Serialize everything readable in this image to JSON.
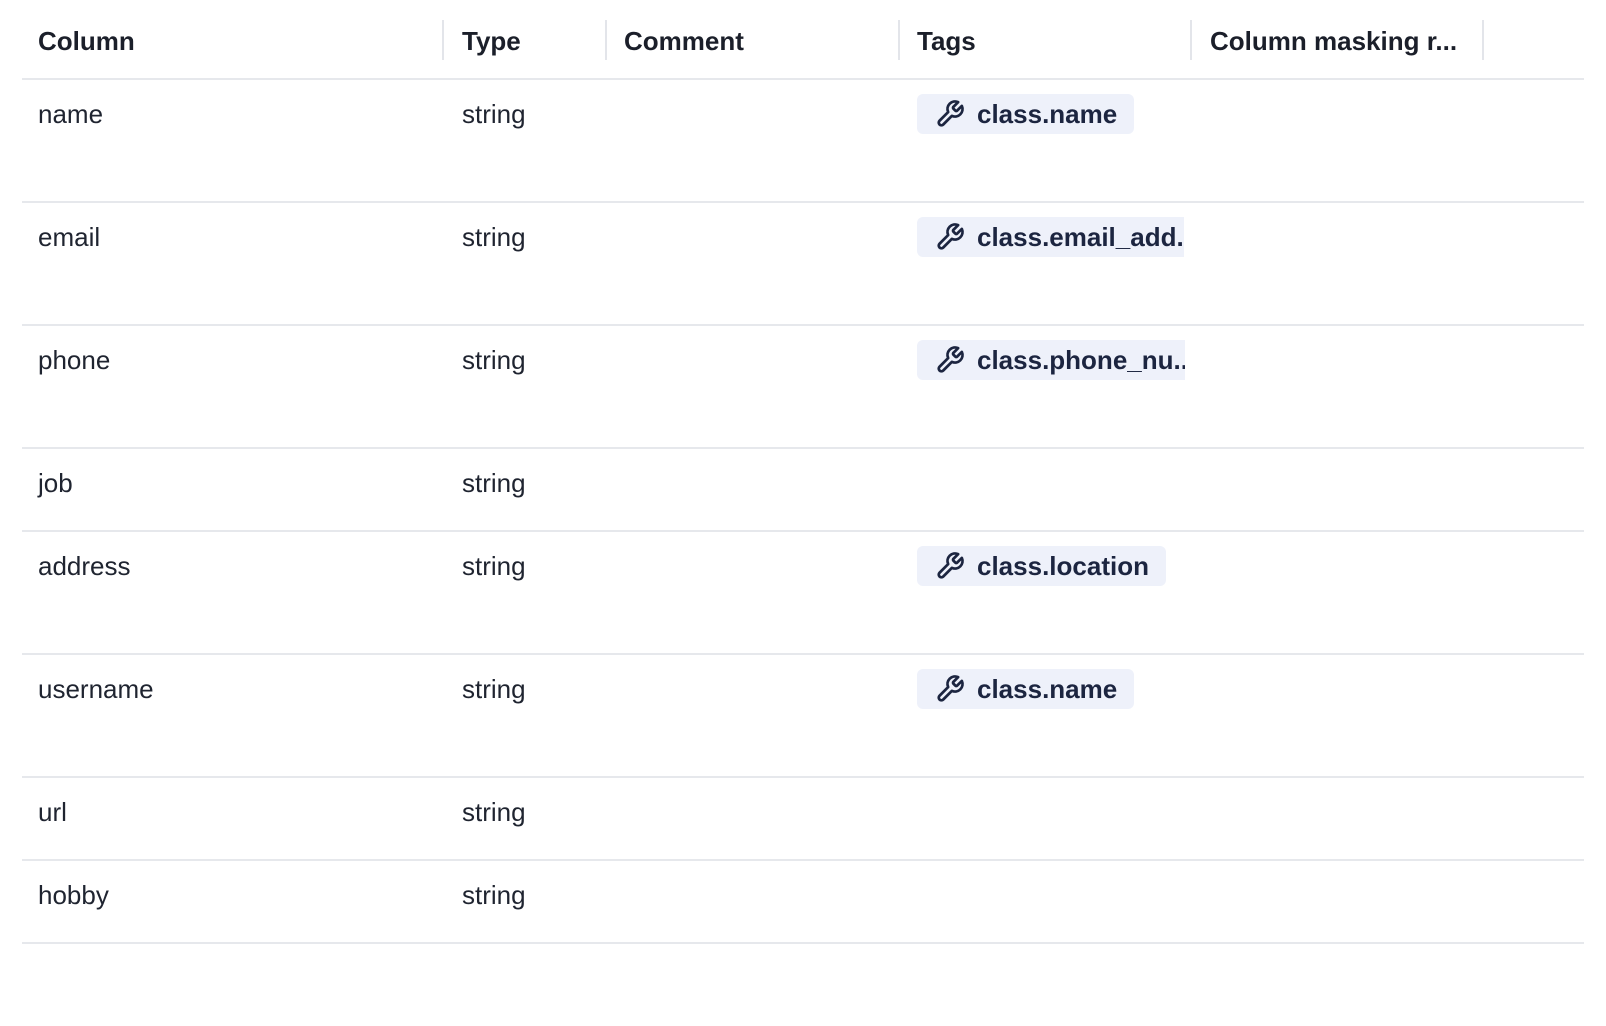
{
  "table": {
    "headers": [
      "Column",
      "Type",
      "Comment",
      "Tags",
      "Column masking r..."
    ],
    "rows": [
      {
        "column": "name",
        "type": "string",
        "tag": "class.name"
      },
      {
        "column": "email",
        "type": "string",
        "tag": "class.email_add."
      },
      {
        "column": "phone",
        "type": "string",
        "tag": "class.phone_nu.."
      },
      {
        "column": "job",
        "type": "string",
        "tag": null
      },
      {
        "column": "address",
        "type": "string",
        "tag": "class.location"
      },
      {
        "column": "username",
        "type": "string",
        "tag": "class.name"
      },
      {
        "column": "url",
        "type": "string",
        "tag": null
      },
      {
        "column": "hobby",
        "type": "string",
        "tag": null
      }
    ],
    "tag_icon": "wrench-icon",
    "colors": {
      "tag_background": "#eef1fa",
      "tag_text": "#1c2540",
      "divider": "#e6e8ec"
    }
  }
}
